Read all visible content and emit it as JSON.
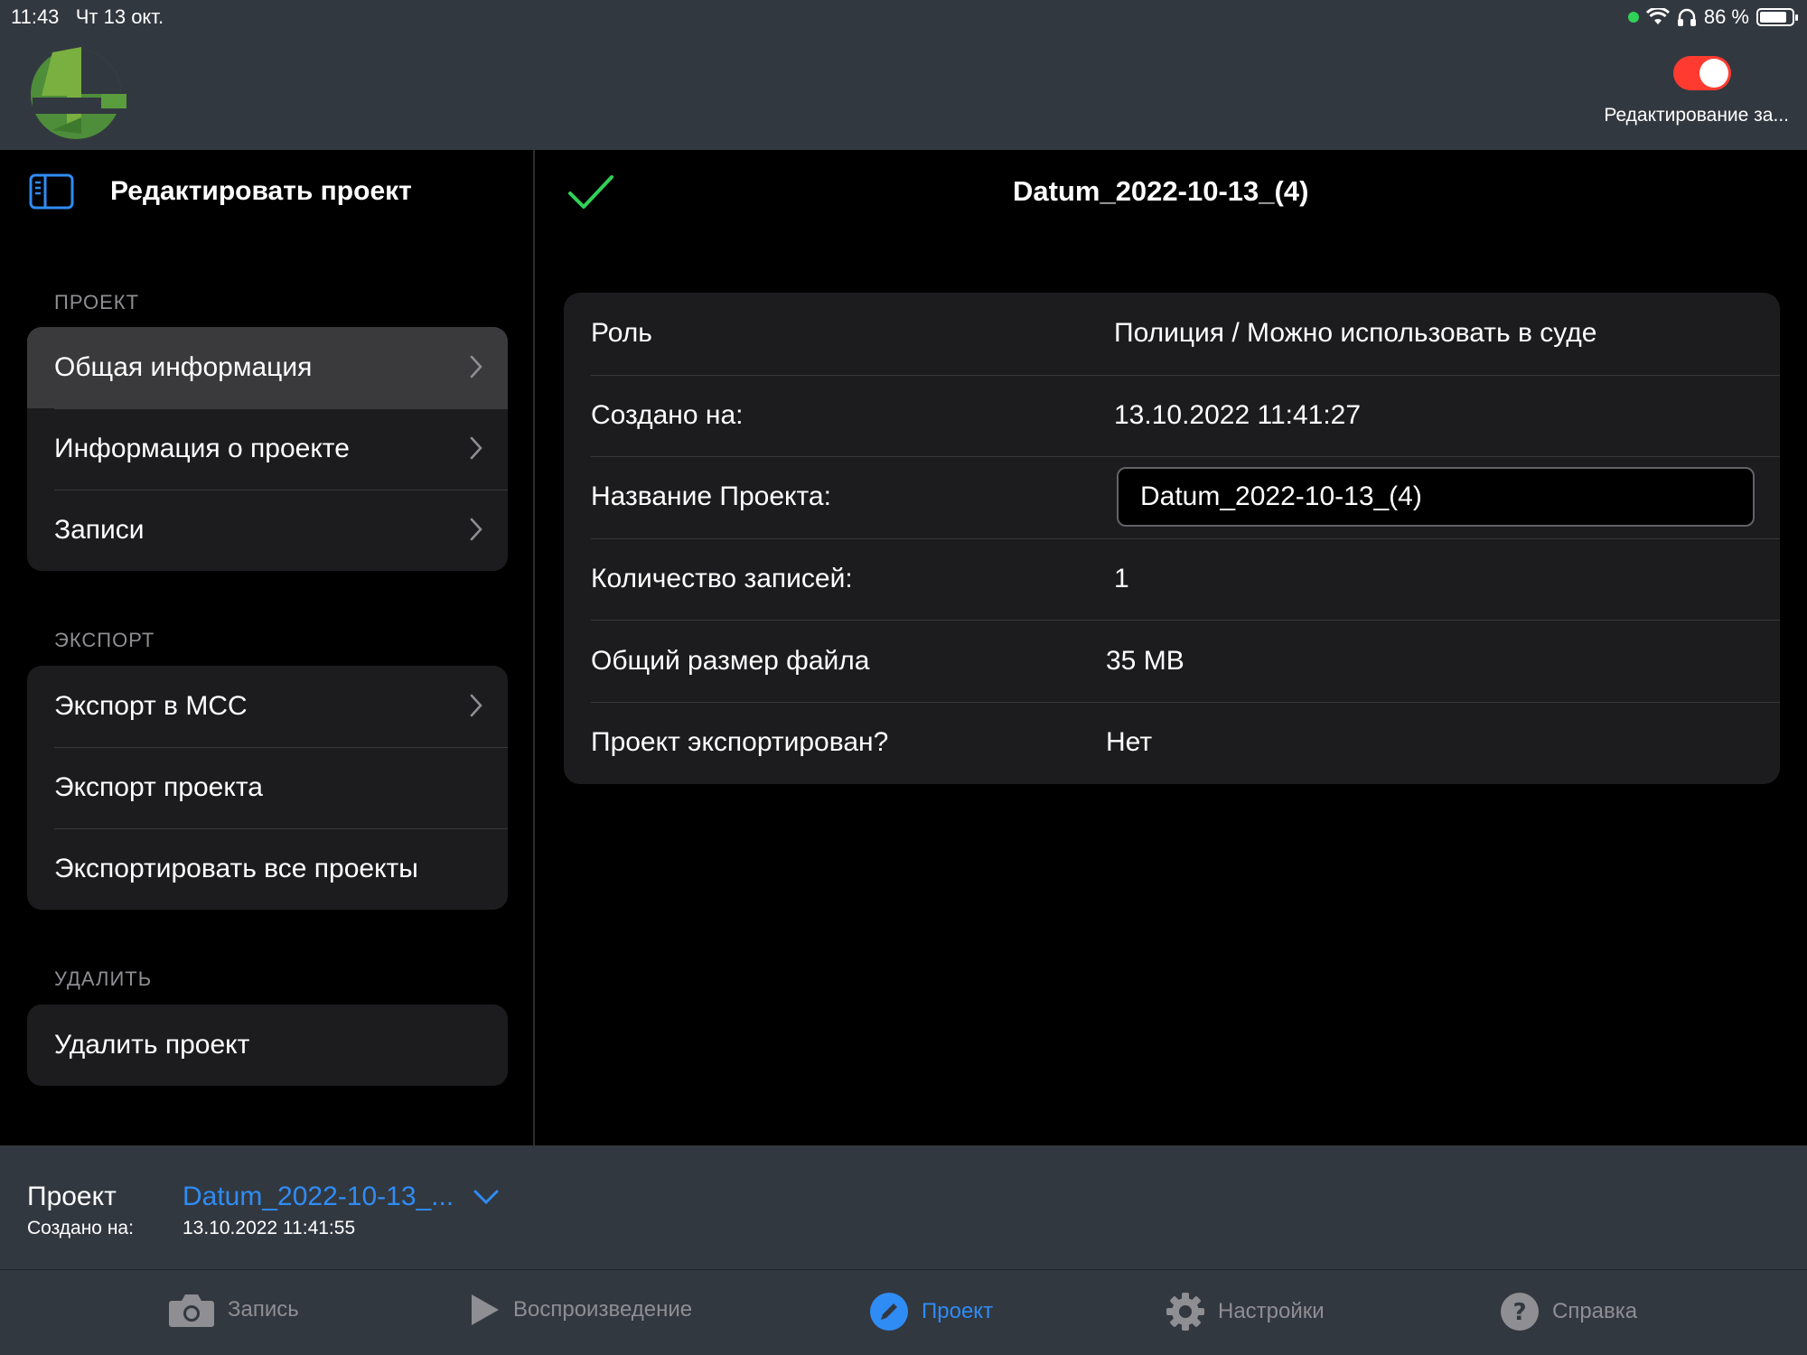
{
  "status_bar": {
    "time": "11:43",
    "date": "Чт 13 окт.",
    "battery": "86 %",
    "battery_level": 0.86
  },
  "header": {
    "logo_icon": "app-logo-4",
    "toggle_state": "on",
    "toggle_label": "Редактирование за..."
  },
  "sidebar": {
    "title": "Редактировать проект",
    "toggle_icon": "sidebar-toggle-icon",
    "sections": [
      {
        "label": "ПРОЕКТ",
        "items": [
          {
            "label": "Общая информация",
            "chevron": true,
            "selected": true
          },
          {
            "label": "Информация о проекте",
            "chevron": true,
            "selected": false
          },
          {
            "label": "Записи",
            "chevron": true,
            "selected": false
          }
        ]
      },
      {
        "label": "ЭКСПОРТ",
        "items": [
          {
            "label": "Экспорт в MCC",
            "chevron": true,
            "selected": false
          },
          {
            "label": "Экспорт проекта",
            "chevron": false,
            "selected": false
          },
          {
            "label": "Экспортировать все проекты",
            "chevron": false,
            "selected": false
          }
        ]
      },
      {
        "label": "УДАЛИТЬ",
        "items": [
          {
            "label": "Удалить проект",
            "chevron": false,
            "selected": false
          }
        ]
      }
    ]
  },
  "main": {
    "title": "Datum_2022-10-13_(4)",
    "confirm_icon": "checkmark-icon",
    "rows": [
      {
        "label": "Роль",
        "value": "Полиция / Можно использовать в суде"
      },
      {
        "label": "Создано на:",
        "value": "13.10.2022 11:41:27"
      },
      {
        "label": "Название Проекта:",
        "input_value": "Datum_2022-10-13_(4)"
      },
      {
        "label": "Количество записей:",
        "value": "1"
      },
      {
        "label": "Общий размер файла",
        "value": "35 MB"
      },
      {
        "label": "Проект экспортирован?",
        "value": "Нет"
      }
    ]
  },
  "project_bar": {
    "title": "Проект",
    "created_label": "Создано на:",
    "project_name": "Datum_2022-10-13_...",
    "created_date": "13.10.2022 11:41:55"
  },
  "tabs": [
    {
      "label": "Запись",
      "icon": "camera-icon",
      "active": false
    },
    {
      "label": "Воспроизведение",
      "icon": "play-icon",
      "active": false
    },
    {
      "label": "Проект",
      "icon": "pencil-icon",
      "active": true
    },
    {
      "label": "Настройки",
      "icon": "gear-icon",
      "active": false
    },
    {
      "label": "Справка",
      "icon": "help-icon",
      "active": false
    }
  ],
  "colors": {
    "accent": "#2f8cf4",
    "toggle_on": "#ff3b30",
    "check": "#30d158",
    "bar_bg": "#323840",
    "card_bg": "#1c1c1e"
  }
}
